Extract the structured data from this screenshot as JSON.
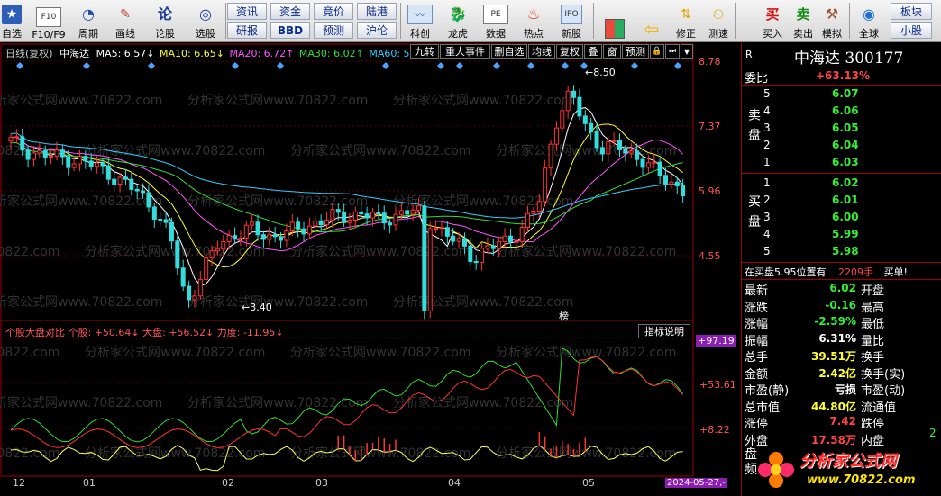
{
  "toolbar": {
    "items": [
      {
        "label": "自选",
        "icon": "star-icon"
      },
      {
        "label": "F10/F9",
        "icon": "f10-icon"
      },
      {
        "label": "周期",
        "icon": "period-icon"
      },
      {
        "label": "画线",
        "icon": "pencil-icon"
      },
      {
        "label": "论股",
        "icon": "discuss-icon"
      },
      {
        "label": "选股",
        "icon": "stock-picker-icon"
      }
    ],
    "grid_buttons": [
      "资讯",
      "资金",
      "竞价",
      "陆港",
      "研报",
      "BBD",
      "预测",
      "沪伦"
    ],
    "items2": [
      {
        "label": "科创",
        "icon": "kechuang-icon"
      },
      {
        "label": "龙虎",
        "icon": "dragon-tiger-icon"
      },
      {
        "label": "数据",
        "icon": "pe-data-icon"
      },
      {
        "label": "热点",
        "icon": "hot-spot-icon"
      },
      {
        "label": "新股",
        "icon": "ipo-icon"
      }
    ],
    "items3": [
      {
        "label": "",
        "icon": "color-grid-icon"
      },
      {
        "label": "",
        "icon": "arrow-left-icon"
      },
      {
        "label": "修正",
        "icon": "correct-icon"
      },
      {
        "label": "测速",
        "icon": "speed-test-icon"
      },
      {
        "label": "买入",
        "icon": "buy-icon"
      },
      {
        "label": "卖出",
        "icon": "sell-icon"
      },
      {
        "label": "模拟",
        "icon": "simulate-icon"
      },
      {
        "label": "全球",
        "icon": "globe-icon"
      }
    ],
    "buy_glyph": "买",
    "sell_glyph": "卖",
    "right_buttons": [
      "板块",
      "小股"
    ]
  },
  "chart": {
    "title_prefix": "日线(复权)",
    "stock_name": "中海达",
    "ma5": "MA5: 6.57↓",
    "ma10": "MA10: 6.65↓",
    "ma20": "MA20: 6.72↑",
    "ma30": "MA30: 6.02↑",
    "ma60": "MA60: 5",
    "buttons": [
      "九转",
      "重大事件",
      "删自选",
      "均线",
      "复权",
      "叠",
      "窗",
      "预测",
      "🔒",
      "⏭",
      "▼"
    ],
    "price_axis": [
      "8.78",
      "7.37",
      "5.96",
      "4.55"
    ],
    "high_label": "8.50",
    "low_label": "3.40",
    "event_label": "榜",
    "indicator_title": "个股大盘对比 个股: +50.64↓ 大盘: +56.52↓ 力度: -11.95↓",
    "indicator_btn": "指标说明",
    "ind_axis": [
      "+97.19",
      "+53.61",
      "+8.22"
    ],
    "date_axis": [
      "12",
      "01",
      "02",
      "03",
      "04",
      "05"
    ],
    "date_tag": "2024-05-27,-",
    "watermark": "分析家公式网www.70822.com"
  },
  "chart_data": {
    "type": "line",
    "title": "",
    "price_range": [
      3.4,
      8.78
    ],
    "indicator_range": [
      -12,
      97.19
    ],
    "x": [
      0,
      5,
      10,
      15,
      20,
      25,
      30,
      35,
      40,
      45,
      50,
      55,
      60,
      65,
      70,
      75,
      80,
      85,
      90,
      95,
      100,
      105,
      110,
      115,
      120,
      125,
      130,
      135,
      140,
      145,
      150,
      155,
      160,
      165,
      170,
      175,
      180,
      185,
      190,
      195,
      200,
      205,
      210
    ],
    "candles_close": [
      7.1,
      6.9,
      6.8,
      6.75,
      6.7,
      6.6,
      6.45,
      6.2,
      6.0,
      5.6,
      5.0,
      3.6,
      4.3,
      4.9,
      5.1,
      5.2,
      5.05,
      5.1,
      5.2,
      5.35,
      5.45,
      5.5,
      5.55,
      5.4,
      5.5,
      5.6,
      5.5,
      5.1,
      4.9,
      4.6,
      4.8,
      5.0,
      5.2,
      5.8,
      7.5,
      8.1,
      7.4,
      6.9,
      7.0,
      6.8,
      6.5,
      6.3,
      6.02
    ],
    "ma_lines": [
      {
        "name": "MA5",
        "color": "#ffffff"
      },
      {
        "name": "MA10",
        "color": "#ffff33"
      },
      {
        "name": "MA20",
        "color": "#ff55ff"
      },
      {
        "name": "MA30",
        "color": "#33dd33"
      },
      {
        "name": "MA60",
        "color": "#33ccff"
      }
    ],
    "indicator_series": [
      {
        "color": "#33dd33"
      },
      {
        "color": "#ff3333"
      },
      {
        "color": "#ffff66"
      }
    ]
  },
  "panel": {
    "header": "中海达  300177",
    "r_label": "R",
    "weibi_label": "委比",
    "weibi": "+63.13%",
    "sell_side": "卖盘",
    "buy_side": "买盘",
    "sells": [
      {
        "n": "5",
        "p": "6.07"
      },
      {
        "n": "4",
        "p": "6.06"
      },
      {
        "n": "3",
        "p": "6.05"
      },
      {
        "n": "2",
        "p": "6.04"
      },
      {
        "n": "1",
        "p": "6.03"
      }
    ],
    "buys": [
      {
        "n": "1",
        "p": "6.02"
      },
      {
        "n": "2",
        "p": "6.01"
      },
      {
        "n": "3",
        "p": "6.00"
      },
      {
        "n": "4",
        "p": "5.99"
      },
      {
        "n": "5",
        "p": "5.98"
      }
    ],
    "notice": "在买盘5.95位置有",
    "notice_vol": "2209手",
    "notice_tail": "买单!",
    "stats": [
      {
        "k": "最新",
        "v": "6.02",
        "k2": "开盘",
        "color": "#33ee33"
      },
      {
        "k": "涨跌",
        "v": "-0.16",
        "k2": "最高",
        "color": "#33ee33"
      },
      {
        "k": "涨幅",
        "v": "-2.59%",
        "k2": "最低",
        "color": "#33ee33"
      },
      {
        "k": "振幅",
        "v": "6.31%",
        "k2": "量比",
        "color": "#ffffff"
      },
      {
        "k": "总手",
        "v": "39.51万",
        "k2": "换手",
        "color": "#ffff33"
      },
      {
        "k": "金额",
        "v": "2.42亿",
        "k2": "换手(实)",
        "color": "#ffff33"
      },
      {
        "k": "市盈(静)",
        "v": "亏损",
        "k2": "市盈(动)",
        "color": "#ffffff"
      },
      {
        "k": "总市值",
        "v": "44.80亿",
        "k2": "流通值",
        "color": "#ffff33"
      },
      {
        "k": "涨停",
        "v": "7.42",
        "k2": "跌停",
        "color": "#ff4444"
      },
      {
        "k": "外盘",
        "v": "17.58万",
        "k2": "内盘",
        "color": "#ff4444"
      }
    ],
    "bottom_partial": "盘",
    "bottom_char": "频",
    "bottom_right": "2",
    "logo_text": "分析家公式网",
    "logo_url": "www.70822.com"
  }
}
